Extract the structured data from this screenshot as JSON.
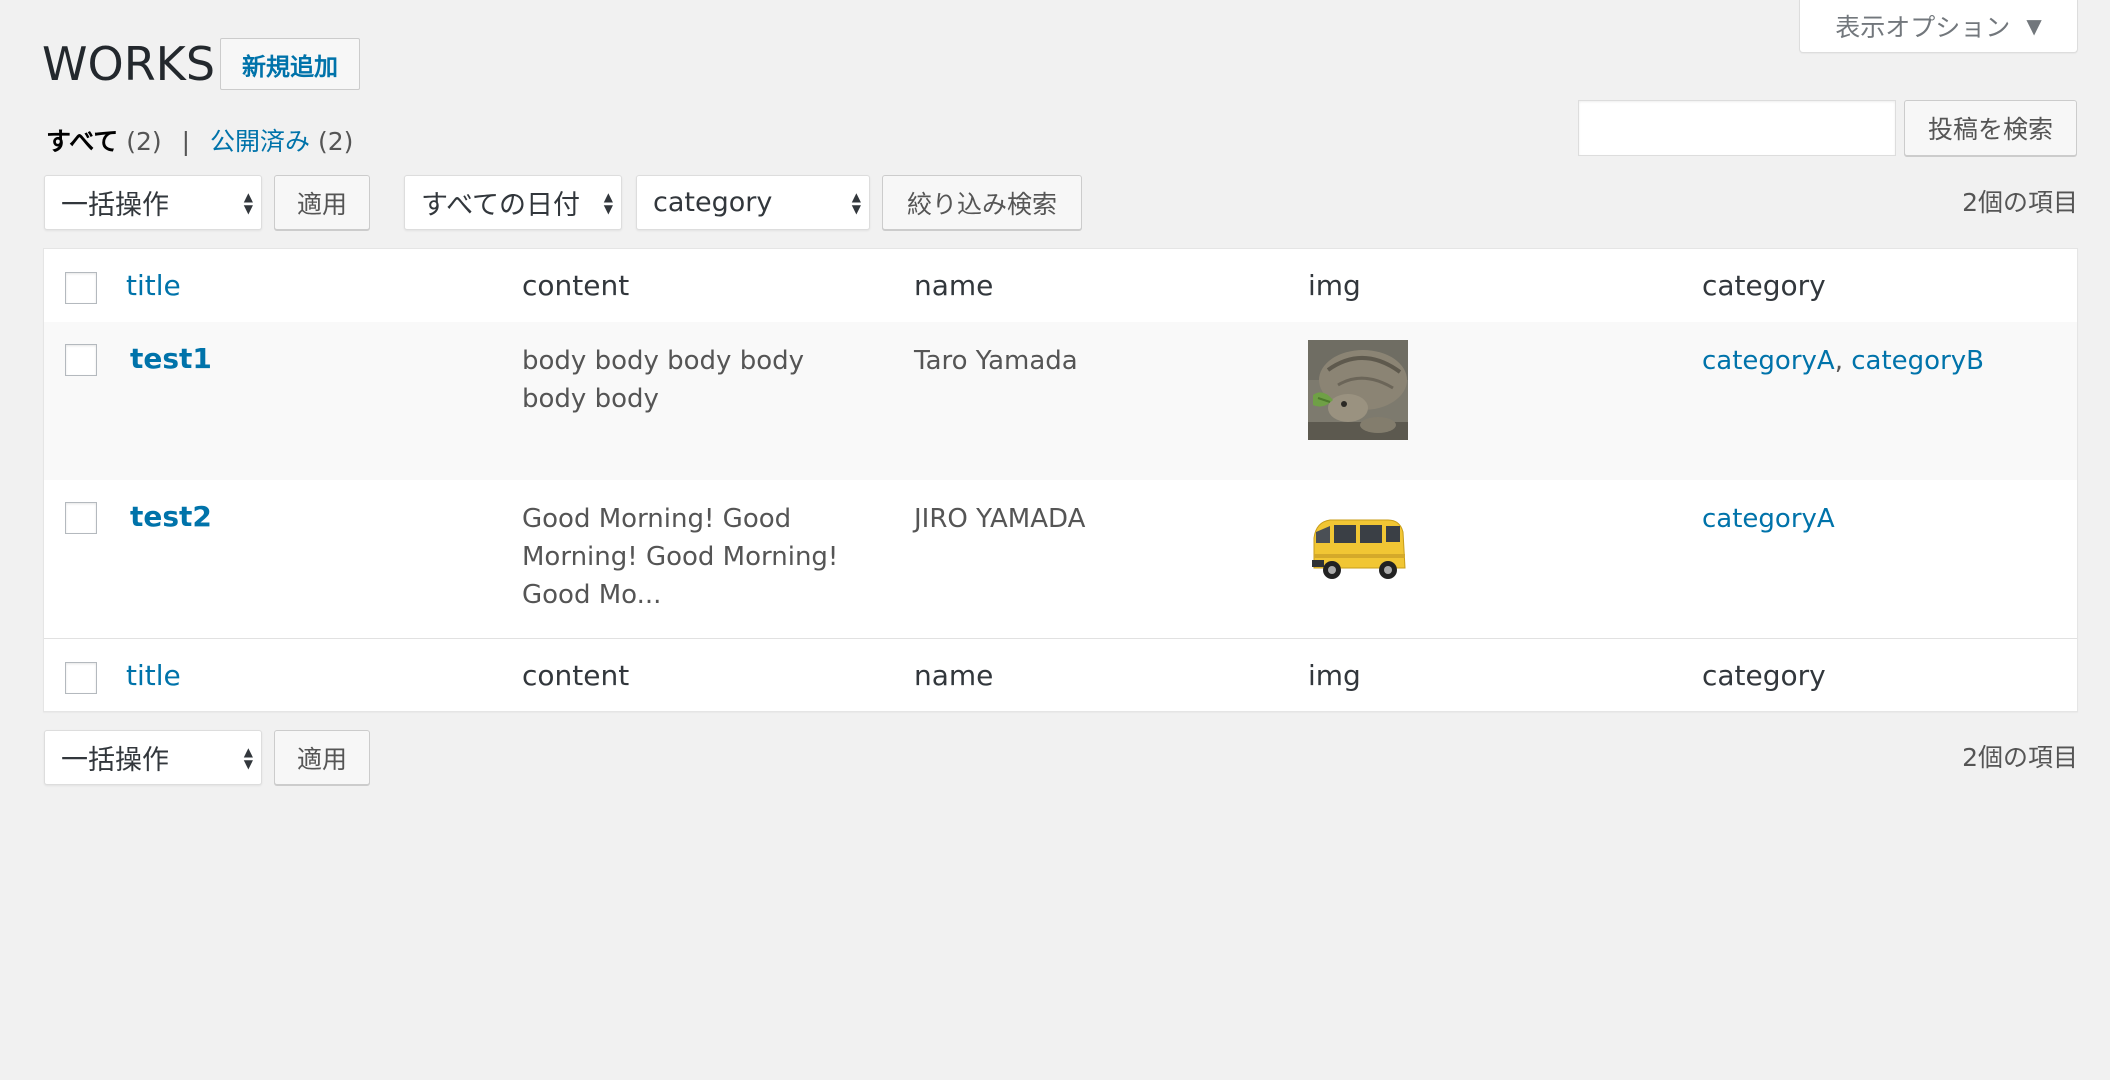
{
  "screen_options": {
    "label": "表示オプション",
    "caret": "▼"
  },
  "page": {
    "title": "WORKS",
    "add_new_label": "新規追加"
  },
  "views": {
    "all_label": "すべて",
    "all_count": "(2)",
    "separator": "|",
    "published_label": "公開済み",
    "published_count": "(2)"
  },
  "search": {
    "value": "",
    "placeholder": "",
    "button_label": "投稿を検索"
  },
  "tablenav_top": {
    "bulk_action": "一括操作",
    "apply_label": "適用",
    "date_filter": "すべての日付",
    "category_filter": "category",
    "filter_label": "絞り込み検索",
    "items_count": "2個の項目"
  },
  "table": {
    "columns": [
      "title",
      "content",
      "name",
      "img",
      "category"
    ],
    "rows": [
      {
        "title": "test1",
        "content": "body body body body body body",
        "name": "Taro Yamada",
        "img": "tortoise-photo",
        "categories": [
          "categoryA",
          "categoryB"
        ],
        "category_separator": ","
      },
      {
        "title": "test2",
        "content": "Good Morning! Good Morning! Good Morning! Good Mo...",
        "name": "JIRO YAMADA",
        "img": "yellow-car-photo",
        "categories": [
          "categoryA"
        ]
      }
    ]
  },
  "tablenav_bottom": {
    "bulk_action": "一括操作",
    "apply_label": "適用",
    "items_count": "2個の項目"
  },
  "colors": {
    "link": "#0073aa",
    "background": "#f1f1f1",
    "text": "#23282d"
  }
}
